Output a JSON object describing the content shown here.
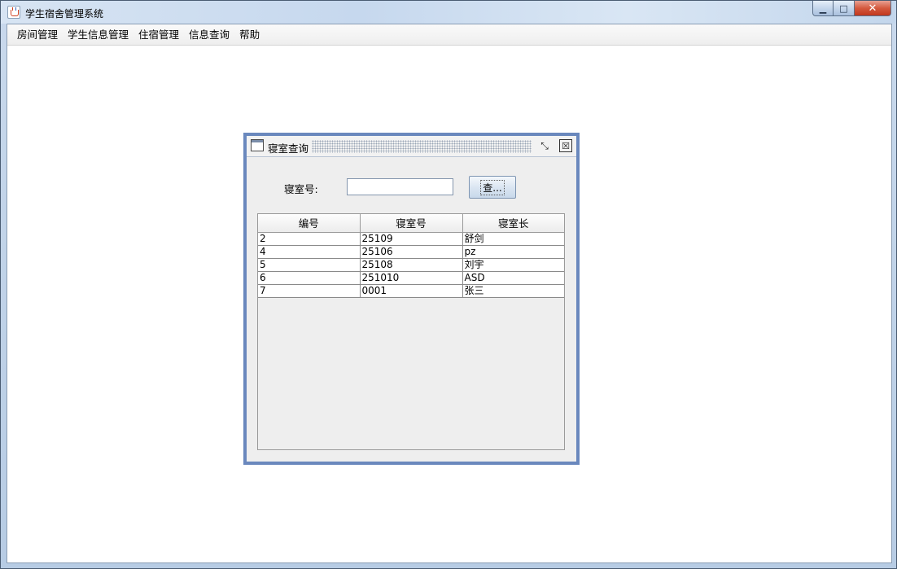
{
  "window": {
    "title": "学生宿舍管理系统",
    "minimize": "▁",
    "maximize": "□",
    "close": "✕"
  },
  "menubar": {
    "items": [
      "房间管理",
      "学生信息管理",
      "住宿管理",
      "信息查询",
      "帮助"
    ]
  },
  "dialog": {
    "title": "寝室查询",
    "restore_icon": "⤡",
    "close_icon": "☒",
    "query_label": "寝室号:",
    "query_value": "",
    "query_button": "查..."
  },
  "table": {
    "columns": [
      "编号",
      "寝室号",
      "寝室长"
    ],
    "rows": [
      [
        "2",
        "25109",
        "舒剑"
      ],
      [
        "4",
        "25106",
        "pz"
      ],
      [
        "5",
        "25108",
        "刘宇"
      ],
      [
        "6",
        "251010",
        "ASD"
      ],
      [
        "7",
        "0001",
        "张三"
      ]
    ]
  }
}
